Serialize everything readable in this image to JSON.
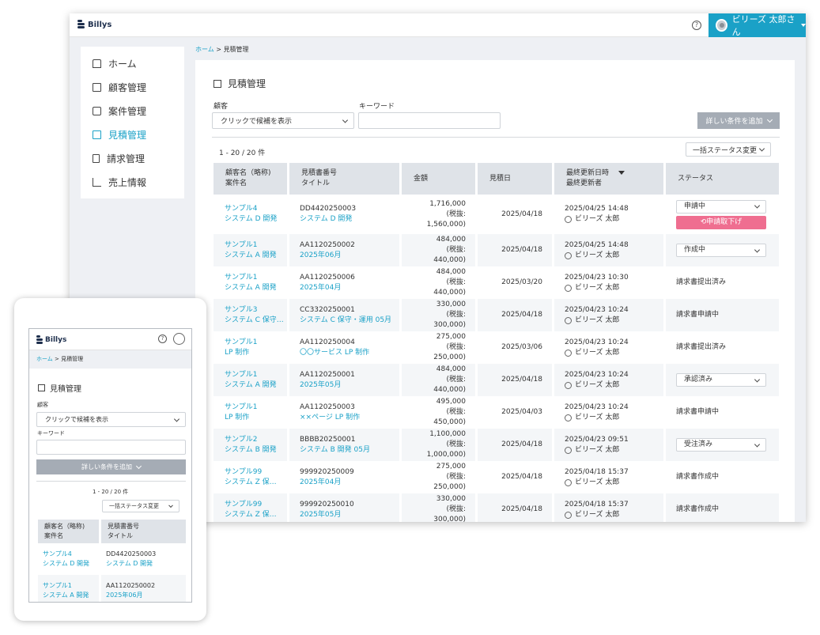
{
  "app": {
    "brand": "Billys",
    "help_icon": "?",
    "user_name": "ビリーズ 太郎さん"
  },
  "sidebar": {
    "items": [
      {
        "label": "ホーム",
        "icon": "home-icon"
      },
      {
        "label": "顧客管理",
        "icon": "building-icon"
      },
      {
        "label": "案件管理",
        "icon": "briefcase-icon"
      },
      {
        "label": "見積管理",
        "icon": "calculator-icon",
        "active": true
      },
      {
        "label": "請求管理",
        "icon": "document-icon"
      },
      {
        "label": "売上情報",
        "icon": "bar-chart-icon"
      }
    ]
  },
  "breadcrumb": {
    "home": "ホーム",
    "sep": " > ",
    "current": "見積管理"
  },
  "page": {
    "title": "見積管理",
    "customer_label": "顧客",
    "customer_placeholder": "クリックで候補を表示",
    "keyword_label": "キーワード",
    "more_filters_label": "詳しい条件を追加",
    "count": "1 - 20 / 20 件",
    "bulk_status_label": "一括ステータス変更"
  },
  "table": {
    "headers": [
      [
        "顧客名（略称)",
        "案件名"
      ],
      [
        "見積書番号",
        "タイトル"
      ],
      [
        "金額",
        ""
      ],
      [
        "見積日",
        ""
      ],
      [
        "最終更新日時",
        "最終更新者"
      ],
      [
        "ステータス",
        ""
      ]
    ],
    "rows": [
      {
        "customer": "サンプル4",
        "project": "システム D 開発",
        "number": "DD4420250003",
        "title": "システム D 開発",
        "amount": "1,716,000",
        "tax": "(税抜: 1,560,000)",
        "date": "2025/04/18",
        "updated": "2025/04/25 14:48",
        "updater": "ビリーズ 太郎",
        "status": "申請中",
        "status_type": "select",
        "action": "申請取下げ"
      },
      {
        "customer": "サンプル1",
        "project": "システム A 開発",
        "number": "AA1120250002",
        "title": "2025年06月",
        "amount": "484,000",
        "tax": "(税抜: 440,000)",
        "date": "2025/04/18",
        "updated": "2025/04/25 14:48",
        "updater": "ビリーズ 太郎",
        "status": "作成中",
        "status_type": "select"
      },
      {
        "customer": "サンプル1",
        "project": "システム A 開発",
        "number": "AA1120250006",
        "title": "2025年04月",
        "amount": "484,000",
        "tax": "(税抜: 440,000)",
        "date": "2025/03/20",
        "updated": "2025/04/23 10:30",
        "updater": "ビリーズ 太郎",
        "status": "請求書提出済み",
        "status_type": "text"
      },
      {
        "customer": "サンプル3",
        "project": "システム C 保守…",
        "number": "CC3320250001",
        "title": "システム C 保守・運用 05月",
        "amount": "330,000",
        "tax": "(税抜: 300,000)",
        "date": "2025/04/18",
        "updated": "2025/04/23 10:24",
        "updater": "ビリーズ 太郎",
        "status": "請求書申請中",
        "status_type": "text"
      },
      {
        "customer": "サンプル1",
        "project": "LP 制作",
        "number": "AA1120250004",
        "title": "〇〇サービス LP 制作",
        "amount": "275,000",
        "tax": "(税抜: 250,000)",
        "date": "2025/03/06",
        "updated": "2025/04/23 10:24",
        "updater": "ビリーズ 太郎",
        "status": "請求書提出済み",
        "status_type": "text"
      },
      {
        "customer": "サンプル1",
        "project": "システム A 開発",
        "number": "AA1120250001",
        "title": "2025年05月",
        "amount": "484,000",
        "tax": "(税抜: 440,000)",
        "date": "2025/04/18",
        "updated": "2025/04/23 10:24",
        "updater": "ビリーズ 太郎",
        "status": "承認済み",
        "status_type": "select"
      },
      {
        "customer": "サンプル1",
        "project": "LP 制作",
        "number": "AA1120250003",
        "title": "××ページ LP 制作",
        "amount": "495,000",
        "tax": "(税抜: 450,000)",
        "date": "2025/04/03",
        "updated": "2025/04/23 10:24",
        "updater": "ビリーズ 太郎",
        "status": "請求書申請中",
        "status_type": "text"
      },
      {
        "customer": "サンプル2",
        "project": "システム B 開発",
        "number": "BBBB20250001",
        "title": "システム B 開発 05月",
        "amount": "1,100,000",
        "tax": "(税抜: 1,000,000)",
        "date": "2025/04/18",
        "updated": "2025/04/23 09:51",
        "updater": "ビリーズ 太郎",
        "status": "受注済み",
        "status_type": "select"
      },
      {
        "customer": "サンプル99",
        "project": "システム Z 保…",
        "number": "999920250009",
        "title": "2025年04月",
        "amount": "275,000",
        "tax": "(税抜: 250,000)",
        "date": "2025/04/18",
        "updated": "2025/04/18 15:37",
        "updater": "ビリーズ 太郎",
        "status": "請求書作成中",
        "status_type": "text"
      },
      {
        "customer": "サンプル99",
        "project": "システム Z 保…",
        "number": "999920250010",
        "title": "2025年05月",
        "amount": "330,000",
        "tax": "(税抜: 300,000)",
        "date": "2025/04/18",
        "updated": "2025/04/18 15:37",
        "updater": "ビリーズ 太郎",
        "status": "請求書作成中",
        "status_type": "text"
      }
    ]
  },
  "mobile": {
    "brand": "Billys",
    "breadcrumb_home": "ホーム",
    "breadcrumb_current": "見積管理",
    "title": "見積管理",
    "customer_label": "顧客",
    "customer_placeholder": "クリックで候補を表示",
    "keyword_label": "キーワード",
    "more_filters_label": "詳しい条件を追加",
    "count": "1 - 20 / 20 件",
    "bulk_status_label": "一括ステータス変更",
    "headers": [
      [
        "顧客名（略称)",
        "案件名"
      ],
      [
        "見積書番号",
        "タイトル"
      ]
    ],
    "rows": [
      {
        "customer": "サンプル4",
        "project": "システム D 開発",
        "number": "DD4420250003",
        "title": "システム D 開発"
      },
      {
        "customer": "サンプル1",
        "project": "システム A 開発",
        "number": "AA1120250002",
        "title": "2025年06月"
      }
    ]
  },
  "colors": {
    "accent": "#1aa1c7",
    "pink": "#ef6e90",
    "gray_button": "#a5acb5",
    "header_bg": "#dfe3e8"
  }
}
